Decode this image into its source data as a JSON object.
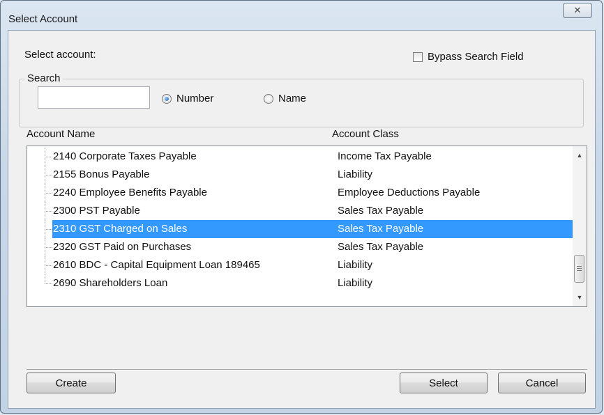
{
  "window": {
    "title": "Select Account",
    "close_glyph": "✕"
  },
  "prompt_label": "Select account:",
  "bypass_checkbox": {
    "label": "Bypass Search Field",
    "checked": false
  },
  "search": {
    "group_label": "Search",
    "input_value": "",
    "radio_number": {
      "label": "Number",
      "selected": true
    },
    "radio_name": {
      "label": "Name",
      "selected": false
    }
  },
  "list": {
    "columns": {
      "name": "Account Name",
      "class": "Account Class"
    },
    "rows": [
      {
        "name": "2140 Corporate Taxes Payable",
        "class": "Income Tax Payable",
        "selected": false
      },
      {
        "name": "2155 Bonus Payable",
        "class": "Liability",
        "selected": false
      },
      {
        "name": "2240 Employee Benefits Payable",
        "class": "Employee Deductions Payable",
        "selected": false
      },
      {
        "name": "2300 PST Payable",
        "class": "Sales Tax Payable",
        "selected": false
      },
      {
        "name": "2310 GST Charged on Sales",
        "class": "Sales Tax Payable",
        "selected": true
      },
      {
        "name": "2320 GST Paid on Purchases",
        "class": "Sales Tax Payable",
        "selected": false
      },
      {
        "name": "2610 BDC - Capital Equipment Loan 189465",
        "class": "Liability",
        "selected": false
      },
      {
        "name": "2690 Shareholders Loan",
        "class": "Liability",
        "selected": false
      }
    ],
    "scroll_up_glyph": "▲",
    "scroll_down_glyph": "▼"
  },
  "buttons": {
    "create": "Create",
    "select": "Select",
    "cancel": "Cancel"
  },
  "colors": {
    "selection": "#3399ff",
    "radio_selected": "#1a5fb4"
  },
  "icons": {
    "close": "close-icon",
    "scroll_up": "scroll-up-arrow-icon",
    "scroll_down": "scroll-down-arrow-icon"
  }
}
